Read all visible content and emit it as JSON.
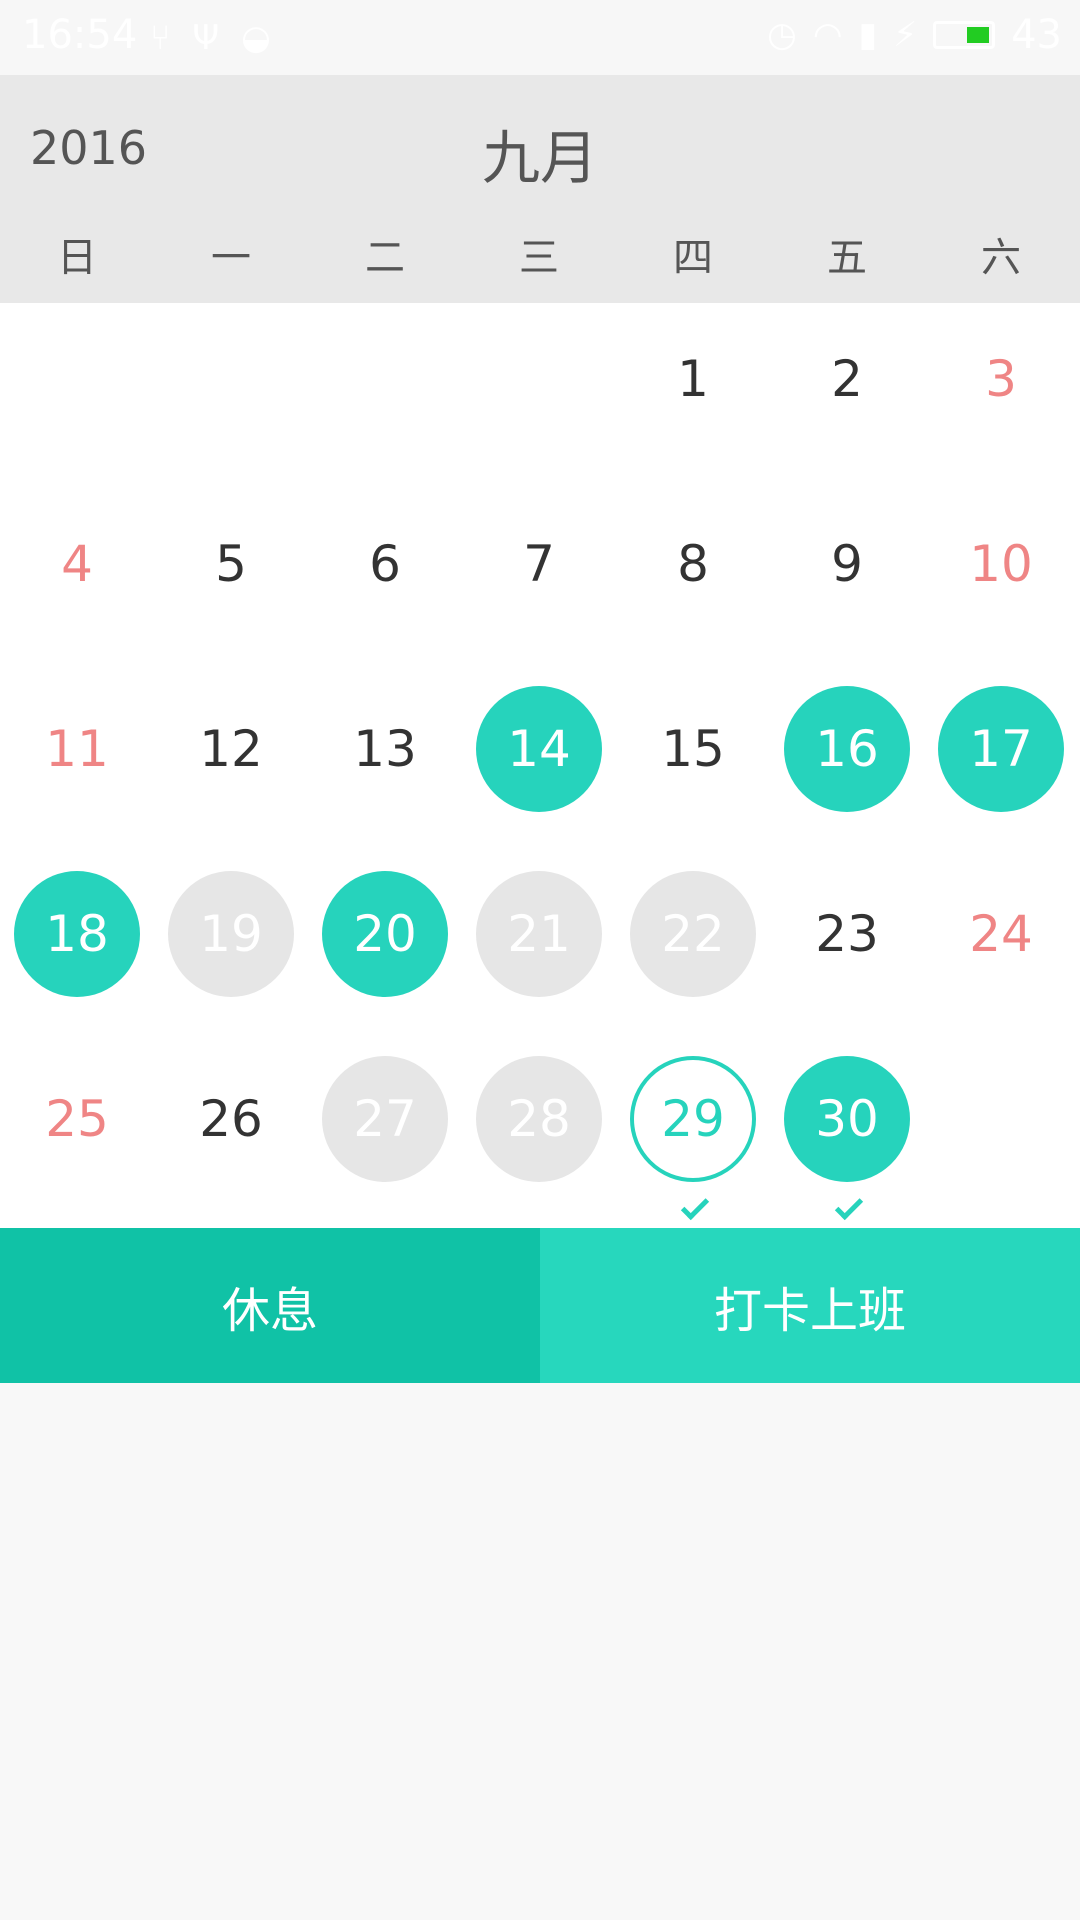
{
  "status_bar": {
    "time": "16:54",
    "battery_percent": "43",
    "battery_color": "#22cc22",
    "left_icons": [
      "usb-icon",
      "usb-debug-icon",
      "sync-icon"
    ],
    "right_icons": [
      "alarm-icon",
      "wifi-icon",
      "signal-icon",
      "charging-icon",
      "battery-icon"
    ]
  },
  "header": {
    "year": "2016",
    "month": "九月",
    "weekdays": [
      "日",
      "一",
      "二",
      "三",
      "四",
      "五",
      "六"
    ]
  },
  "calendar": {
    "days": [
      {
        "day": "1",
        "state": "normal"
      },
      {
        "day": "2",
        "state": "normal"
      },
      {
        "day": "3",
        "state": "weekend"
      },
      {
        "day": "4",
        "state": "weekend"
      },
      {
        "day": "5",
        "state": "normal"
      },
      {
        "day": "6",
        "state": "normal"
      },
      {
        "day": "7",
        "state": "normal"
      },
      {
        "day": "8",
        "state": "normal"
      },
      {
        "day": "9",
        "state": "normal"
      },
      {
        "day": "10",
        "state": "weekend"
      },
      {
        "day": "11",
        "state": "weekend"
      },
      {
        "day": "12",
        "state": "normal"
      },
      {
        "day": "13",
        "state": "normal"
      },
      {
        "day": "14",
        "state": "worked"
      },
      {
        "day": "15",
        "state": "normal"
      },
      {
        "day": "16",
        "state": "worked"
      },
      {
        "day": "17",
        "state": "worked"
      },
      {
        "day": "18",
        "state": "worked"
      },
      {
        "day": "19",
        "state": "missed"
      },
      {
        "day": "20",
        "state": "worked"
      },
      {
        "day": "21",
        "state": "missed"
      },
      {
        "day": "22",
        "state": "missed"
      },
      {
        "day": "23",
        "state": "normal"
      },
      {
        "day": "24",
        "state": "weekend"
      },
      {
        "day": "25",
        "state": "weekend"
      },
      {
        "day": "26",
        "state": "normal"
      },
      {
        "day": "27",
        "state": "missed"
      },
      {
        "day": "28",
        "state": "missed"
      },
      {
        "day": "29",
        "state": "today",
        "checked": true
      },
      {
        "day": "30",
        "state": "worked",
        "checked": true
      }
    ]
  },
  "colors": {
    "accent": "#26d3bc",
    "weekend": "#ef8585",
    "missed": "#e6e6e6"
  },
  "actions": {
    "rest_label": "休息",
    "clock_in_label": "打卡上班"
  }
}
